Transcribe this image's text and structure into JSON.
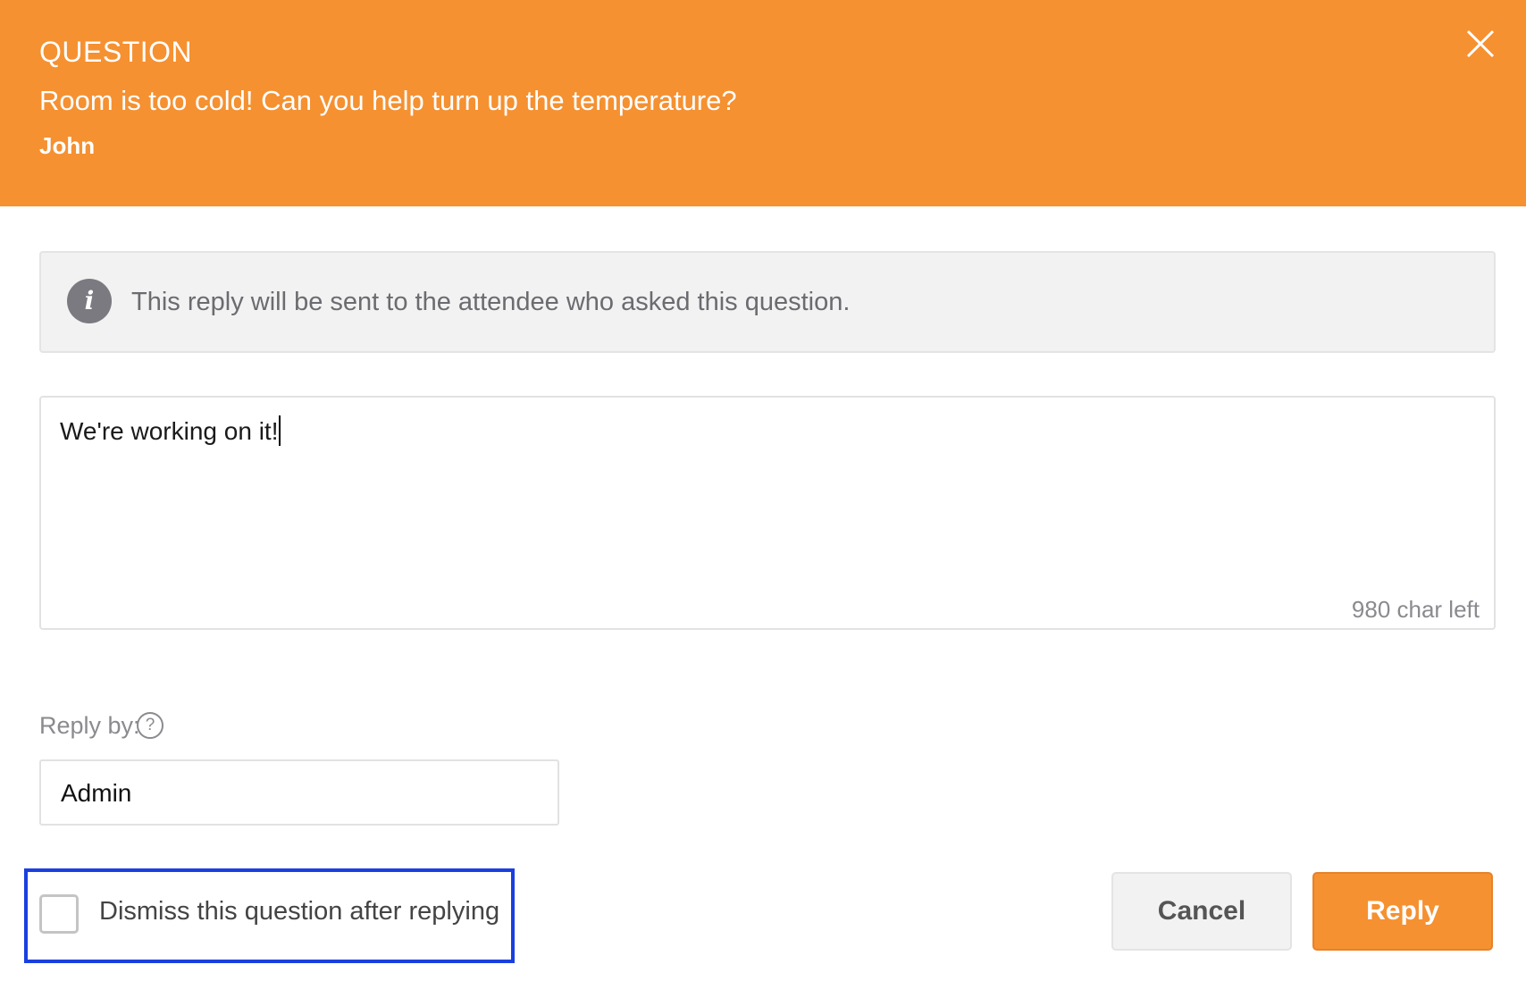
{
  "header": {
    "kind": "QUESTION",
    "question": "Room is too cold! Can you help turn up the temperature?",
    "author": "John",
    "close_icon": "close-icon"
  },
  "info": {
    "icon": "info-icon",
    "text": "This reply will be sent to the attendee who asked this question."
  },
  "reply": {
    "value": "We're working on it!",
    "chars_left": "980 char left"
  },
  "reply_by": {
    "label": "Reply by:",
    "help_icon": "question-circle-icon",
    "value": "Admin"
  },
  "dismiss": {
    "label": "Dismiss this question after replying",
    "checked": false,
    "highlight_color": "#1a3fe0"
  },
  "buttons": {
    "cancel": "Cancel",
    "reply": "Reply"
  },
  "colors": {
    "accent": "#f59131"
  }
}
